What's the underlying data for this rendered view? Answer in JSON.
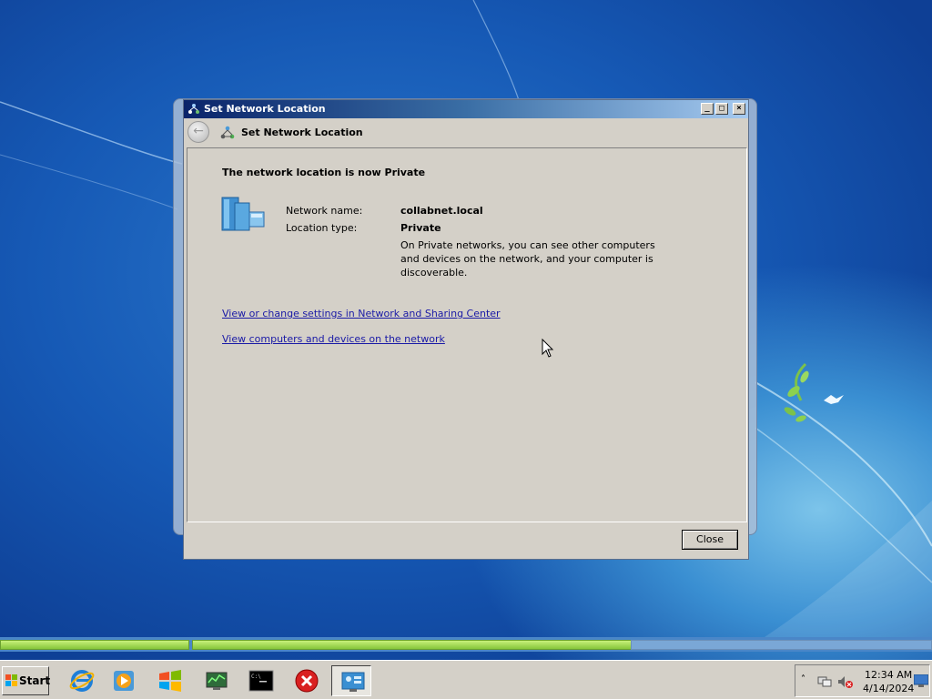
{
  "window": {
    "title": "Set Network Location",
    "buttons": {
      "minimize": "_",
      "maximize": "□",
      "close": "×"
    }
  },
  "nav": {
    "title": "Set Network Location"
  },
  "content": {
    "heading": "The network location is now Private",
    "network_name_label": "Network name:",
    "network_name_value": "collabnet.local",
    "location_type_label": "Location type:",
    "location_type_value": "Private",
    "description": "On Private networks, you can see other computers and devices on the network, and your computer is discoverable.",
    "link_sharing_center": "View or change settings in Network and Sharing Center",
    "link_view_computers": "View computers and devices on the network"
  },
  "footer": {
    "close_label": "Close"
  },
  "taskbar": {
    "start_label": "Start",
    "pinned": [
      "internet-explorer-icon",
      "media-player-icon",
      "windows-explorer-icon",
      "network-monitor-icon",
      "command-prompt-icon",
      "error-icon",
      "network-settings-icon"
    ]
  },
  "tray": {
    "chevron": "˄",
    "time": "12:34 AM",
    "date": "4/14/2024"
  },
  "colors": {
    "title_bar": "#0a246a",
    "link": "#1a1aa6",
    "progress_green": "#86c63a",
    "desktop_blue": "#1659b5"
  }
}
